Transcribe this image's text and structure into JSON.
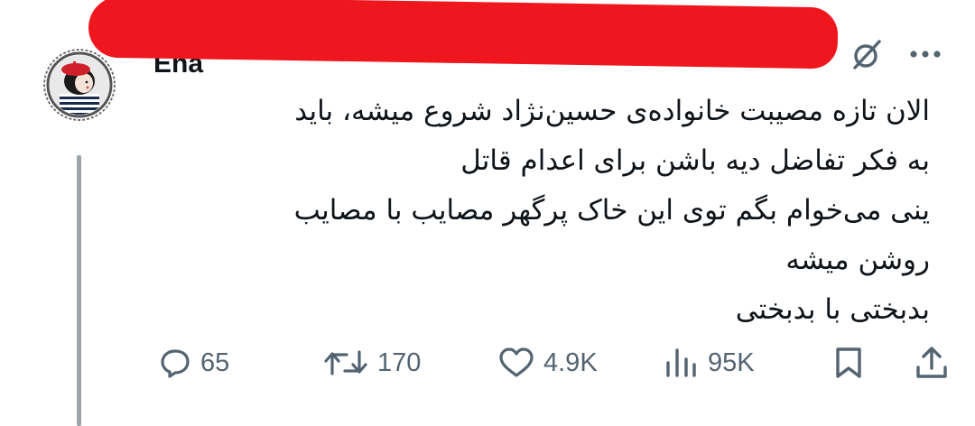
{
  "header": {
    "author_name": "Ena",
    "icons": {
      "grok": "slashed-circle-icon",
      "more": "more-horizontal-icon"
    }
  },
  "avatar": {
    "icon": "avatar-image"
  },
  "tweet": {
    "lines": [
      "الان تازه مصیبت خانواده‌ی حسین‌نژاد شروع میشه، باید",
      "به فکر تفاضل دیه باشن برای اعدام قاتل",
      "ینی می‌خوام بگم توی این خاک پرگهر مصایب با مصایب",
      "روشن میشه",
      "بدبختی با بدبختی"
    ]
  },
  "actions": {
    "replies": "65",
    "retweets": "170",
    "likes": "4.9K",
    "views": "95K",
    "icons": [
      "reply-icon",
      "retweet-icon",
      "like-icon",
      "views-icon",
      "bookmark-icon",
      "share-icon"
    ]
  },
  "colors": {
    "text": "#0f1419",
    "secondary": "#536471",
    "redaction": "#f0161e",
    "thread_line": "#9ca3ab"
  }
}
